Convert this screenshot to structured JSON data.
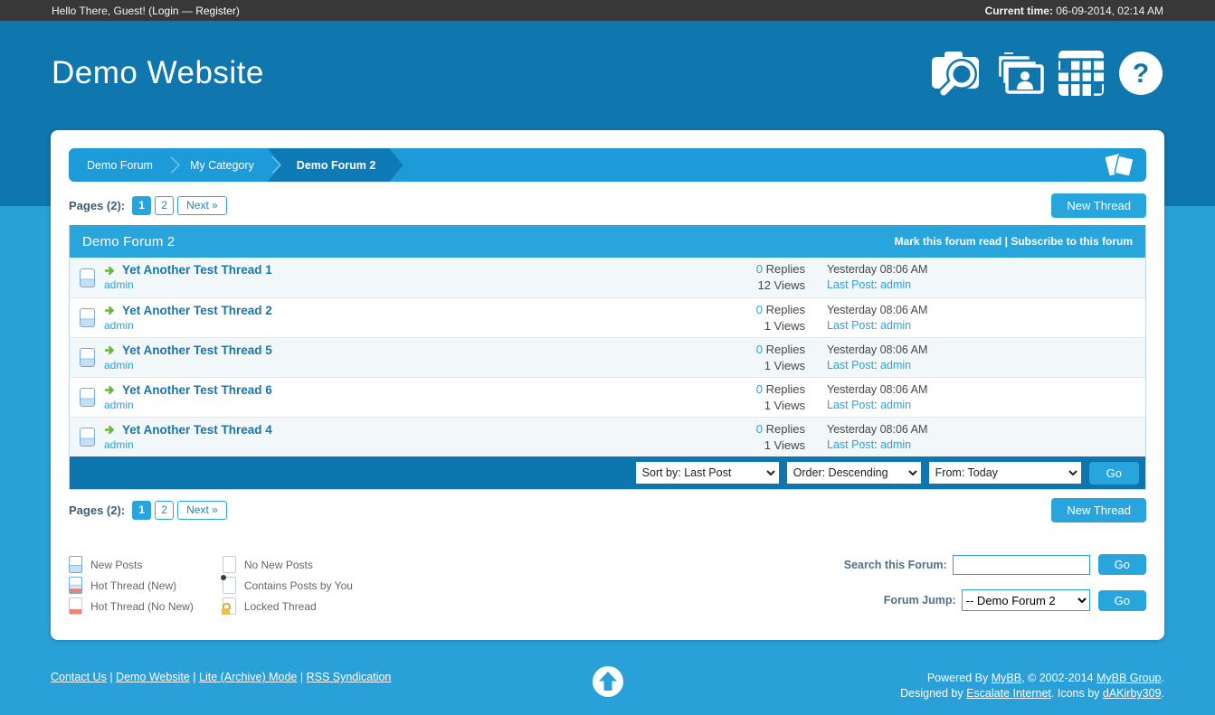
{
  "colors": {
    "accent": "#29a5dd",
    "header_blue": "#0f76ae",
    "page_blue": "#29a0d8",
    "topbar_bg": "#383838",
    "sortbar_blue": "#0d76af"
  },
  "topbar": {
    "greeting_prefix": "Hello There, Guest! (",
    "login_label": "Login",
    "link_separator": " — ",
    "register_label": "Register",
    "greeting_suffix": ")",
    "time_label": "Current time:",
    "time_value": " 06-09-2014, 02:14 AM"
  },
  "header": {
    "site_title": "Demo Website",
    "icons": [
      "search-icon",
      "memberlist-icon",
      "calendar-icon",
      "help-icon"
    ]
  },
  "breadcrumb": {
    "item1": "Demo Forum",
    "item2": "My Category",
    "active": "Demo Forum 2",
    "corner_icon": "pages-icon"
  },
  "pagination": {
    "label": "Pages (2):",
    "current_page": "1",
    "page2": "2",
    "next_label": "Next »"
  },
  "buttons": {
    "new_thread": "New Thread"
  },
  "forum_header": {
    "title": "Demo Forum 2",
    "mark_read": "Mark this forum read",
    "divider": "|",
    "subscribe": "Subscribe to this forum"
  },
  "thread_labels": {
    "replies": " Replies",
    "views": " Views",
    "last_post": "Last Post",
    "colon": ": "
  },
  "threads": [
    {
      "title": "Yet Another Test Thread 1",
      "author": "admin",
      "replies": "0",
      "views": "12",
      "last_date": "Yesterday 08:06 AM",
      "last_author": "admin"
    },
    {
      "title": "Yet Another Test Thread 2",
      "author": "admin",
      "replies": "0",
      "views": "1",
      "last_date": "Yesterday 08:06 AM",
      "last_author": "admin"
    },
    {
      "title": "Yet Another Test Thread 5",
      "author": "admin",
      "replies": "0",
      "views": "1",
      "last_date": "Yesterday 08:06 AM",
      "last_author": "admin"
    },
    {
      "title": "Yet Another Test Thread 6",
      "author": "admin",
      "replies": "0",
      "views": "1",
      "last_date": "Yesterday 08:06 AM",
      "last_author": "admin"
    },
    {
      "title": "Yet Another Test Thread 4",
      "author": "admin",
      "replies": "0",
      "views": "1",
      "last_date": "Yesterday 08:06 AM",
      "last_author": "admin"
    }
  ],
  "sortbar": {
    "sort_by": "Sort by: Last Post",
    "order": "Order: Descending",
    "from": "From: Today",
    "go": "Go"
  },
  "legend": {
    "items": [
      {
        "icon": "new-posts-icon",
        "label": "New Posts"
      },
      {
        "icon": "hot-thread-new-icon",
        "label": "Hot Thread (New)"
      },
      {
        "icon": "hot-thread-no-new-icon",
        "label": "Hot Thread (No New)"
      },
      {
        "icon": "no-new-posts-icon",
        "label": "No New Posts"
      },
      {
        "icon": "contains-posts-icon",
        "label": "Contains Posts by You"
      },
      {
        "icon": "locked-thread-icon",
        "label": "Locked Thread"
      }
    ]
  },
  "search_forum": {
    "label": "Search this Forum:",
    "value": "",
    "go": "Go"
  },
  "forum_jump": {
    "label": "Forum Jump:",
    "selected": "-- Demo Forum 2",
    "go": "Go"
  },
  "footer": {
    "link1": "Contact Us",
    "link2": "Demo Website",
    "link3": "Lite (Archive) Mode",
    "link4": "RSS Syndication",
    "divider": " | ",
    "powered_prefix": "Powered By ",
    "mybb_link": "MyBB",
    "powered_mid": ", © 2002-2014 ",
    "mybb_group_link": "MyBB Group",
    "period": ".",
    "designed_prefix": "Designed by ",
    "escalate_link": "Escalate Internet",
    "icons_by_mid": ". Icons by ",
    "dakirby_link": "dAKirby309",
    "to_top_icon": "up-arrow-icon"
  }
}
